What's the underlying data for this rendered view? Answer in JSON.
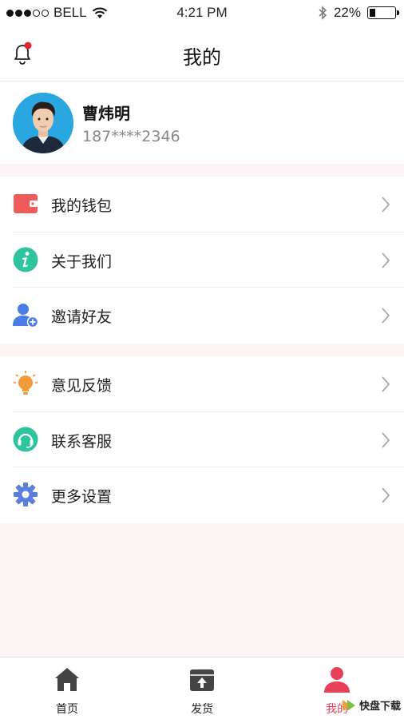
{
  "status_bar": {
    "carrier": "BELL",
    "time": "4:21 PM",
    "battery_percent": "22%",
    "battery_level": 0.22
  },
  "header": {
    "title": "我的"
  },
  "profile": {
    "name": "曹炜明",
    "phone": "187****2346"
  },
  "menu_group_1": [
    {
      "label": "我的钱包",
      "icon": "wallet-icon",
      "color": "#f05a5a"
    },
    {
      "label": "关于我们",
      "icon": "info-icon",
      "color": "#2ec4a0"
    },
    {
      "label": "邀请好友",
      "icon": "add-user-icon",
      "color": "#4a7de8"
    }
  ],
  "menu_group_2": [
    {
      "label": "意见反馈",
      "icon": "lightbulb-icon",
      "color": "#f39a3c"
    },
    {
      "label": "联系客服",
      "icon": "headset-icon",
      "color": "#2ec4a0"
    },
    {
      "label": "更多设置",
      "icon": "gear-icon",
      "color": "#5b7fe0"
    }
  ],
  "tabbar": {
    "tabs": [
      {
        "label": "首页",
        "icon": "home-icon"
      },
      {
        "label": "发货",
        "icon": "ship-icon"
      },
      {
        "label": "我的",
        "icon": "user-icon",
        "active": true
      }
    ],
    "active_color": "#e9405a"
  },
  "watermark": {
    "text": "快盘下载"
  }
}
